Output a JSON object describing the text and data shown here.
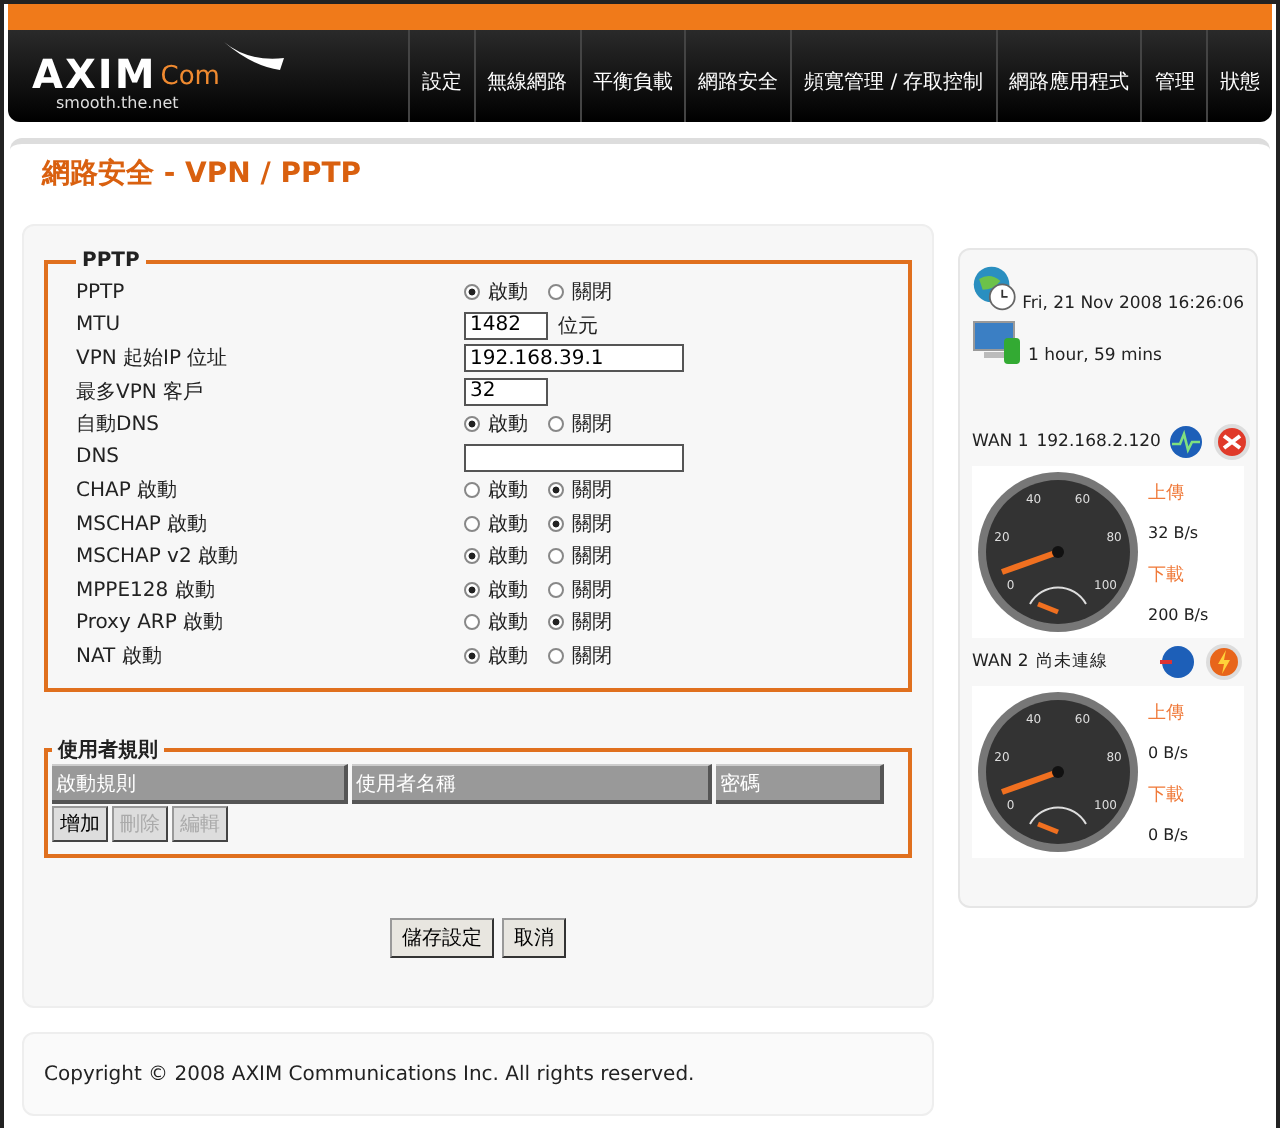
{
  "brand": {
    "name": "AXIM",
    "suffix": "Com",
    "tagline": "smooth.the.net"
  },
  "nav": [
    {
      "label": "設定"
    },
    {
      "label": "無線網路"
    },
    {
      "label": "平衡負載"
    },
    {
      "label": "網路安全"
    },
    {
      "label": "頻寬管理 / 存取控制"
    },
    {
      "label": "網路應用程式"
    },
    {
      "label": "管理"
    },
    {
      "label": "狀態"
    }
  ],
  "page_title": "網路安全 - VPN / PPTP",
  "pptp": {
    "legend": "PPTP",
    "rows": [
      {
        "kind": "radio",
        "label": "PPTP",
        "options": [
          {
            "label": "啟動",
            "selected": true
          },
          {
            "label": "關閉",
            "selected": false
          }
        ]
      },
      {
        "kind": "number",
        "label": "MTU",
        "value": "1482",
        "unit": "位元"
      },
      {
        "kind": "text",
        "label": "VPN 起始IP 位址",
        "value": "192.168.39.1"
      },
      {
        "kind": "number",
        "label": "最多VPN 客戶",
        "value": "32"
      },
      {
        "kind": "radio",
        "label": "自動DNS",
        "options": [
          {
            "label": "啟動",
            "selected": true
          },
          {
            "label": "關閉",
            "selected": false
          }
        ]
      },
      {
        "kind": "text",
        "label": "DNS"
      },
      {
        "kind": "radio",
        "label": "CHAP 啟動",
        "options": [
          {
            "label": "啟動",
            "selected": false
          },
          {
            "label": "關閉",
            "selected": true
          }
        ]
      },
      {
        "kind": "radio",
        "label": "MSCHAP 啟動",
        "options": [
          {
            "label": "啟動",
            "selected": false
          },
          {
            "label": "關閉",
            "selected": true
          }
        ]
      },
      {
        "kind": "radio",
        "label": "MSCHAP v2 啟動",
        "options": [
          {
            "label": "啟動",
            "selected": true
          },
          {
            "label": "關閉",
            "selected": false
          }
        ]
      },
      {
        "kind": "radio",
        "label": "MPPE128 啟動",
        "options": [
          {
            "label": "啟動",
            "selected": true
          },
          {
            "label": "關閉",
            "selected": false
          }
        ]
      },
      {
        "kind": "radio",
        "label": "Proxy ARP 啟動",
        "options": [
          {
            "label": "啟動",
            "selected": false
          },
          {
            "label": "關閉",
            "selected": true
          }
        ]
      },
      {
        "kind": "radio",
        "label": "NAT 啟動",
        "options": [
          {
            "label": "啟動",
            "selected": true
          },
          {
            "label": "關閉",
            "selected": false
          }
        ]
      }
    ]
  },
  "user_rules": {
    "legend": "使用者規則",
    "columns": [
      "啟動規則",
      "使用者名稱",
      "密碼"
    ],
    "buttons": [
      {
        "label": "增加",
        "disabled": false
      },
      {
        "label": "刪除",
        "disabled": true
      },
      {
        "label": "編輯",
        "disabled": true
      }
    ]
  },
  "actions": [
    "儲存設定",
    "取消"
  ],
  "status": {
    "datetime": "Fri, 21 Nov 2008 16:26:06",
    "uptime": "1 hour, 59 mins",
    "wans": [
      {
        "name": "WAN 1",
        "address": "192.168.2.120",
        "connected": true,
        "ticks": [
          "0",
          "20",
          "40",
          "60",
          "80",
          "100"
        ],
        "upload_label": "上傳",
        "upload": "32 B/s",
        "download_label": "下載",
        "download": "200 B/s"
      },
      {
        "name": "WAN 2",
        "address": "尚未連線",
        "connected": false,
        "ticks": [
          "0",
          "20",
          "40",
          "60",
          "80",
          "100"
        ],
        "upload_label": "上傳",
        "upload": "0 B/s",
        "download_label": "下載",
        "download": "0 B/s"
      }
    ]
  },
  "footer": "Copyright © 2008 AXIM Communications Inc. All rights reserved."
}
